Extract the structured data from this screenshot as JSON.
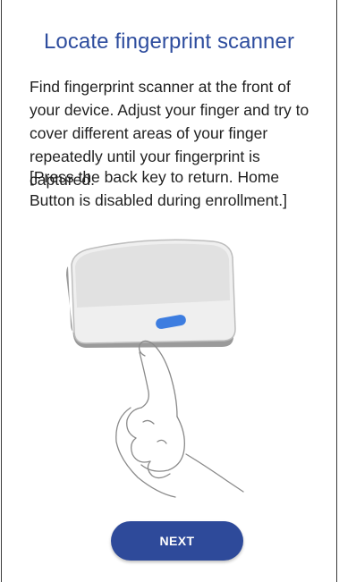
{
  "page": {
    "title": "Locate fingerprint scanner",
    "instructions": "Find fingerprint scanner at the front of your device. Adjust your finger and try to cover different areas of your finger repeatedly until your fingerprint is captured.",
    "note": "[Press the back key to return. Home Button is disabled during enrollment.]"
  },
  "illustration": {
    "icon": "phone-fingerprint-scanner-illustration",
    "sensor_color": "#3d7de0"
  },
  "actions": {
    "next_label": "NEXT"
  },
  "colors": {
    "title": "#2e4d9e",
    "button": "#2e4a9a"
  }
}
